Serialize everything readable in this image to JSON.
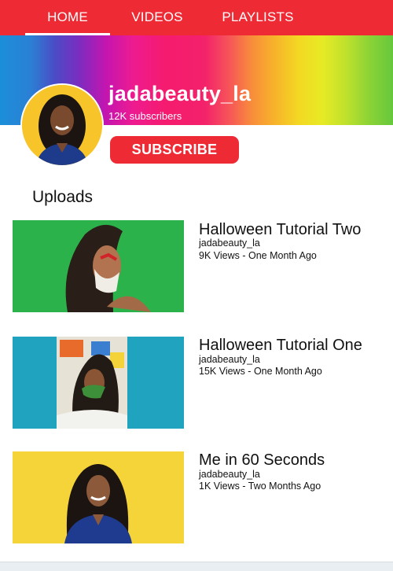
{
  "tabs": [
    {
      "label": "HOME",
      "active": true
    },
    {
      "label": "VIDEOS",
      "active": false
    },
    {
      "label": "PLAYLISTS",
      "active": false
    }
  ],
  "colors": {
    "brand_red": "#ee2a35",
    "thumb1_bg": "#2cb24a",
    "thumb2_bg": "#1fa3bf",
    "thumb3_bg": "#f5d43a"
  },
  "channel": {
    "name": "jadabeauty_la",
    "subscribers": "12K subscribers",
    "avatar_icon": "profile-photo"
  },
  "subscribe_label": "SUBSCRIBE",
  "uploads_heading": "Uploads",
  "videos": [
    {
      "title": "Halloween Tutorial Two",
      "channel": "jadabeauty_la",
      "meta": "9K Views - One Month Ago"
    },
    {
      "title": "Halloween Tutorial One",
      "channel": "jadabeauty_la",
      "meta": "15K Views - One Month Ago"
    },
    {
      "title": "Me in 60 Seconds",
      "channel": "jadabeauty_la",
      "meta": "1K Views - Two Months Ago"
    }
  ]
}
